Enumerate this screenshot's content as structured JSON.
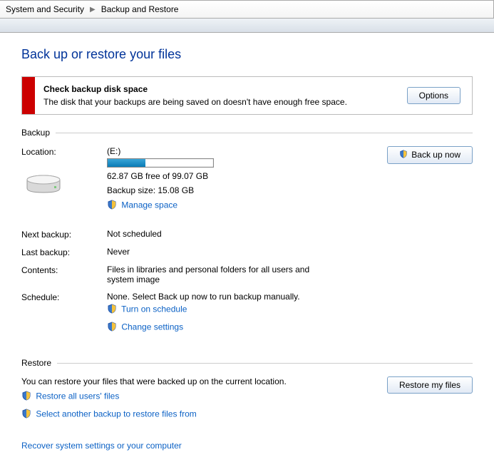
{
  "breadcrumb": {
    "parent": "System and Security",
    "current": "Backup and Restore"
  },
  "page_title": "Back up or restore your files",
  "alert": {
    "title": "Check backup disk space",
    "message": "The disk that your backups are being saved on doesn't have enough free space.",
    "button": "Options"
  },
  "backup": {
    "section": "Backup",
    "location_label": "Location:",
    "drive_name": "(E:)",
    "free_space": "62.87 GB free of 99.07 GB",
    "backup_size": "Backup size: 15.08 GB",
    "manage_space": "Manage space",
    "backup_now": "Back up now",
    "rows": {
      "next_backup": {
        "label": "Next backup:",
        "value": "Not scheduled"
      },
      "last_backup": {
        "label": "Last backup:",
        "value": "Never"
      },
      "contents": {
        "label": "Contents:",
        "value": "Files in libraries and personal folders for all users and system image"
      },
      "schedule": {
        "label": "Schedule:",
        "value": "None. Select Back up now to run backup manually."
      }
    },
    "turn_on_schedule": "Turn on schedule",
    "change_settings": "Change settings"
  },
  "restore": {
    "section": "Restore",
    "text": "You can restore your files that were backed up on the current location.",
    "restore_my_files": "Restore my files",
    "restore_all_users": "Restore all users' files",
    "select_another": "Select another backup to restore files from",
    "recover_system": "Recover system settings or your computer"
  }
}
